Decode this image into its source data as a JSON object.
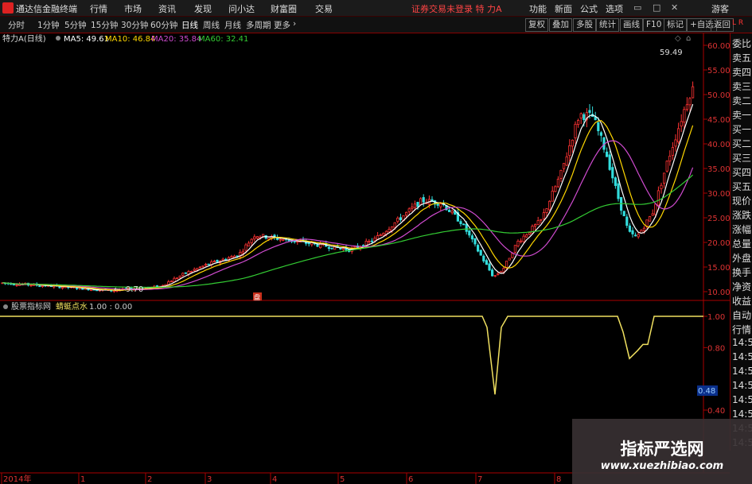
{
  "app": {
    "name": "通达信金融终端",
    "menu": [
      "行情",
      "市场",
      "资讯",
      "发现",
      "问小达",
      "财富圈",
      "交易"
    ],
    "warning": "证券交易未登录  特 力A",
    "right_menu": [
      "功能",
      "新面",
      "公式",
      "选项"
    ],
    "guest": "游客",
    "window_controls": [
      "minimize-icon",
      "maximize-icon",
      "close-icon"
    ]
  },
  "toolbar": {
    "periods": [
      "分时",
      "1分钟",
      "5分钟",
      "15分钟",
      "30分钟",
      "60分钟",
      "日线",
      "周线",
      "月线",
      "多周期",
      "更多"
    ],
    "active_period": "日线",
    "right_buttons": [
      "复权",
      "叠加",
      "多股",
      "统计",
      "画线",
      "F10",
      "标记",
      "+自选",
      "返回"
    ]
  },
  "stock": {
    "title": "特力A(日线)",
    "ma": [
      {
        "label": "MA5: 49.61",
        "color": "#ffffff"
      },
      {
        "label": "MA10: 46.84",
        "color": "#ffd700"
      },
      {
        "label": "MA20: 35.84",
        "color": "#d04bd0"
      },
      {
        "label": "MA60: 32.41",
        "color": "#33cc33"
      }
    ],
    "high_label": "59.49",
    "low_label": "9.70",
    "marker": "盘",
    "price_ticks": [
      "60.00",
      "55.00",
      "50.00",
      "45.00",
      "40.00",
      "35.00",
      "30.00",
      "25.00",
      "20.00",
      "15.00",
      "10.00"
    ]
  },
  "indicator": {
    "source": "股票指标网",
    "name": "蜻蜓点水",
    "value": "1.00 : 0.00",
    "ticks": [
      "1.00",
      "0.80",
      "0.48",
      "0.40"
    ],
    "highlight": "0.48",
    "line_color": "#f0e060"
  },
  "right_panel": {
    "items": [
      "委比",
      "卖五",
      "卖四",
      "卖三",
      "卖二",
      "卖一",
      "买一",
      "买二",
      "买三",
      "买四",
      "买五",
      "现价",
      "涨跌",
      "涨幅",
      "总量",
      "外盘",
      "换手",
      "净资",
      "收益",
      "自动",
      "行情",
      "14:5",
      "14:5",
      "14:5",
      "14:5",
      "14:5",
      "14:5",
      "14:5",
      "14:5"
    ],
    "corner": "L R"
  },
  "xaxis": {
    "labels": [
      "2014年",
      "1",
      "2",
      "3",
      "4",
      "5",
      "6",
      "7",
      "8"
    ]
  },
  "watermark": {
    "title": "指标严选网",
    "url": "www.xuezhibiao.com"
  }
}
